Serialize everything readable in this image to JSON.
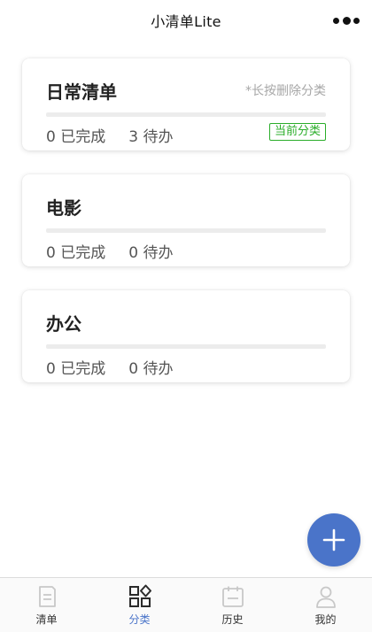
{
  "header": {
    "title": "小清单Lite",
    "more_icon": "more-dots-icon"
  },
  "categories": [
    {
      "name": "日常清单",
      "hint": "*长按删除分类",
      "done_text": "0 已完成",
      "todo_text": "3 待办",
      "progress": 0,
      "badge": "当前分类"
    },
    {
      "name": "电影",
      "done_text": "0 已完成",
      "todo_text": "0 待办",
      "progress": 0
    },
    {
      "name": "办公",
      "done_text": "0 已完成",
      "todo_text": "0 待办",
      "progress": 0
    }
  ],
  "fab": {
    "icon": "plus-icon"
  },
  "tabbar": {
    "active": "分类",
    "tabs": [
      {
        "label": "清单",
        "icon": "list-icon"
      },
      {
        "label": "分类",
        "icon": "category-icon"
      },
      {
        "label": "历史",
        "icon": "history-icon"
      },
      {
        "label": "我的",
        "icon": "profile-icon"
      }
    ]
  },
  "colors": {
    "accent": "#4a74c9",
    "badge": "#2aad29",
    "inactive_icon": "#c8c8c8",
    "active_icon": "#2b2b2b"
  }
}
